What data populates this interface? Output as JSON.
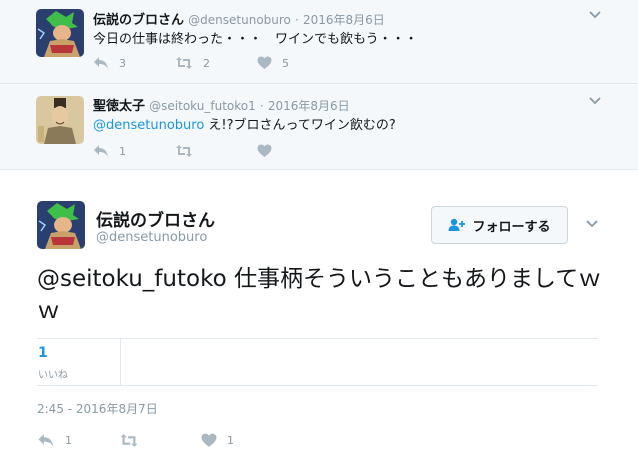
{
  "colors": {
    "link": "#1b95e0",
    "muted": "#8899a6",
    "reply_bg": "#f5f8fa",
    "icon": "#aab8c2"
  },
  "replies": [
    {
      "display_name": "伝説のブロさん",
      "handle": "@densetunoburo",
      "separator": "·",
      "date": "2016年8月6日",
      "text": "今日の仕事は終わった・・・　ワインでも飲もう・・・",
      "reply_count": "3",
      "retweet_count": "2",
      "like_count": "5",
      "avatar_icon": "broly-avatar-icon"
    },
    {
      "display_name": "聖徳太子",
      "handle": "@seitoku_futoko1",
      "separator": "·",
      "date": "2016年8月6日",
      "mention": "@densetunoburo",
      "text": " え!?ブロさんってワイン飲むの?",
      "reply_count": "1",
      "retweet_count": "",
      "like_count": "",
      "avatar_icon": "shotoku-avatar-icon"
    }
  ],
  "main_tweet": {
    "display_name": "伝説のブロさん",
    "handle": "@densetunoburo",
    "follow_label": "フォローする",
    "text": "@seitoku_futoko 仕事柄そういうこともありましてｗｗ",
    "likes_count": "1",
    "likes_label": "いいね",
    "timestamp": "2:45 - 2016年8月7日",
    "reply_count": "1",
    "retweet_count": "",
    "like_count": "1"
  }
}
